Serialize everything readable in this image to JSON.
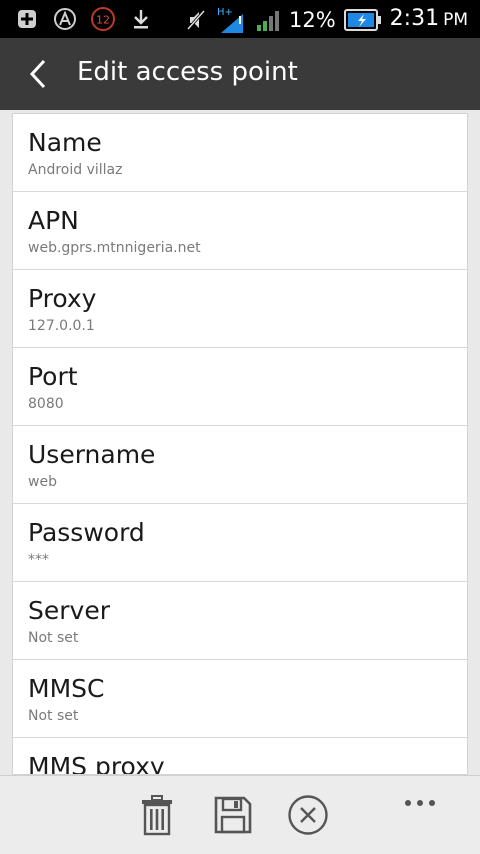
{
  "status_bar": {
    "notification_badge": "12",
    "battery_percent": "12%",
    "network_type": "H+",
    "time": "2:31",
    "ampm": "PM",
    "icons": [
      "add-box-icon",
      "app-logo-icon",
      "badge-12-icon",
      "download-icon",
      "mute-icon",
      "signal-h-plus-icon",
      "signal-bars-icon",
      "battery-charging-icon"
    ]
  },
  "action_bar": {
    "title": "Edit access point",
    "back_icon": "chevron-left-icon"
  },
  "fields": [
    {
      "title": "Name",
      "value": "Android villaz"
    },
    {
      "title": "APN",
      "value": "web.gprs.mtnnigeria.net"
    },
    {
      "title": "Proxy",
      "value": "127.0.0.1"
    },
    {
      "title": "Port",
      "value": "8080"
    },
    {
      "title": "Username",
      "value": "web"
    },
    {
      "title": "Password",
      "value": "***"
    },
    {
      "title": "Server",
      "value": "Not set"
    },
    {
      "title": "MMSC",
      "value": "Not set"
    },
    {
      "title": "MMS proxy",
      "value": ""
    }
  ],
  "toolbar": {
    "icons": [
      "trash-icon",
      "save-icon",
      "cancel-icon",
      "overflow-menu-icon"
    ]
  },
  "colors": {
    "status_bar": "#000000",
    "action_bar": "#3a3a3a",
    "background": "#e9e9e9",
    "card": "#ffffff"
  }
}
